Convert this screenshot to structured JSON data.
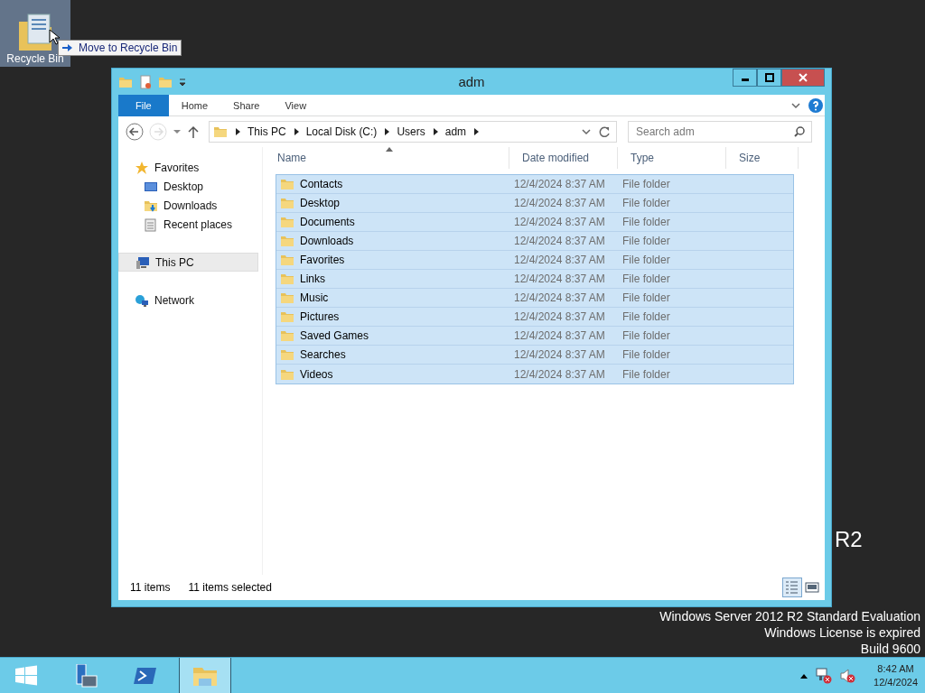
{
  "desktop": {
    "icons": [
      {
        "label": "Recycle Bin",
        "selected": true
      }
    ],
    "drag_tooltip": {
      "text": "Move to Recycle Bin"
    },
    "watermark": [
      "R2",
      "Windows Server 2012 R2 Standard Evaluation",
      "Windows License is expired",
      "Build 9600"
    ]
  },
  "window": {
    "title": "adm",
    "ribbon_tabs": [
      {
        "label": "File",
        "kind": "file",
        "selected": false
      },
      {
        "label": "Home",
        "kind": "tab",
        "selected": false
      },
      {
        "label": "Share",
        "kind": "tab",
        "selected": false
      },
      {
        "label": "View",
        "kind": "tab",
        "selected": false
      }
    ],
    "address": [
      "This PC",
      "Local Disk (C:)",
      "Users",
      "adm"
    ],
    "search": {
      "placeholder": "Search adm"
    },
    "nav": [
      {
        "label": "Favorites",
        "kind": "favorites",
        "selected": false,
        "children": [
          {
            "label": "Desktop",
            "kind": "desktop",
            "selected": false
          },
          {
            "label": "Downloads",
            "kind": "downloads",
            "selected": false
          },
          {
            "label": "Recent places",
            "kind": "recent",
            "selected": false
          }
        ]
      },
      {
        "label": "This PC",
        "kind": "pc",
        "selected": true
      },
      {
        "label": "Network",
        "kind": "network",
        "selected": false
      }
    ],
    "table": {
      "columns": [
        "Name",
        "Date modified",
        "Type",
        "Size"
      ],
      "rows": [
        {
          "name": "Contacts",
          "date": "12/4/2024 8:37 AM",
          "type": "File folder",
          "selected": true
        },
        {
          "name": "Desktop",
          "date": "12/4/2024 8:37 AM",
          "type": "File folder",
          "selected": true
        },
        {
          "name": "Documents",
          "date": "12/4/2024 8:37 AM",
          "type": "File folder",
          "selected": true
        },
        {
          "name": "Downloads",
          "date": "12/4/2024 8:37 AM",
          "type": "File folder",
          "selected": true
        },
        {
          "name": "Favorites",
          "date": "12/4/2024 8:37 AM",
          "type": "File folder",
          "selected": true
        },
        {
          "name": "Links",
          "date": "12/4/2024 8:37 AM",
          "type": "File folder",
          "selected": true
        },
        {
          "name": "Music",
          "date": "12/4/2024 8:37 AM",
          "type": "File folder",
          "selected": true
        },
        {
          "name": "Pictures",
          "date": "12/4/2024 8:37 AM",
          "type": "File folder",
          "selected": true
        },
        {
          "name": "Saved Games",
          "date": "12/4/2024 8:37 AM",
          "type": "File folder",
          "selected": true
        },
        {
          "name": "Searches",
          "date": "12/4/2024 8:37 AM",
          "type": "File folder",
          "selected": true
        },
        {
          "name": "Videos",
          "date": "12/4/2024 8:37 AM",
          "type": "File folder",
          "selected": true
        }
      ]
    },
    "status_bar": [
      "11 items",
      "11 items selected"
    ],
    "view_buttons": [
      {
        "kind": "details",
        "selected": true
      },
      {
        "kind": "tiles",
        "selected": false
      }
    ]
  },
  "taskbar": {
    "apps": [
      {
        "kind": "start",
        "selected": false
      },
      {
        "kind": "server-manager",
        "selected": false
      },
      {
        "kind": "powershell",
        "selected": false
      },
      {
        "kind": "explorer",
        "selected": true
      }
    ],
    "clock": {
      "time": "8:42 AM",
      "date": "12/4/2024"
    }
  }
}
